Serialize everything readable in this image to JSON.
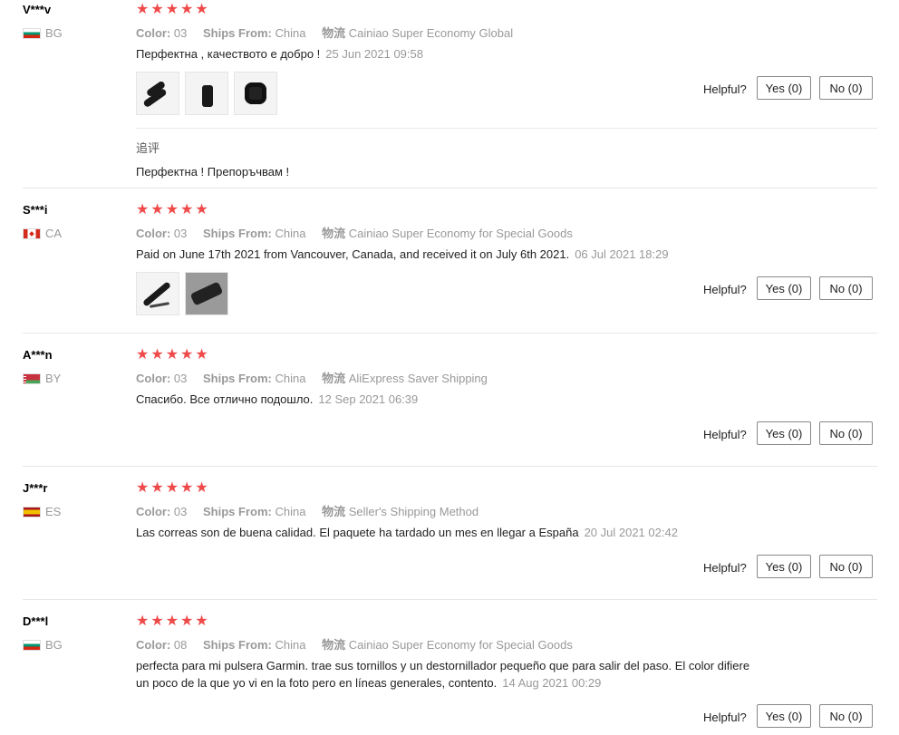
{
  "labels": {
    "color": "Color:",
    "ships_from": "Ships From:",
    "shipping": "物流",
    "helpful": "Helpful?"
  },
  "reviews": [
    {
      "user": "V***v",
      "country": "BG",
      "rating": 5,
      "color": "03",
      "ships_from": "China",
      "shipping": "Cainiao Super Economy Global",
      "text": "Перфектна , качеството е добро !",
      "date": "25 Jun 2021 09:58",
      "photo_count": 3,
      "yes": "Yes (0)",
      "no": "No (0)",
      "followup_label": "追评",
      "followup_text": "Перфектна ! Препоръчвам !"
    },
    {
      "user": "S***i",
      "country": "CA",
      "rating": 5,
      "color": "03",
      "ships_from": "China",
      "shipping": "Cainiao Super Economy for Special Goods",
      "text": "Paid on June 17th 2021 from Vancouver, Canada, and received it on July 6th 2021.",
      "date": "06 Jul 2021 18:29",
      "photo_count": 2,
      "yes": "Yes (0)",
      "no": "No (0)"
    },
    {
      "user": "A***n",
      "country": "BY",
      "rating": 5,
      "color": "03",
      "ships_from": "China",
      "shipping": "AliExpress Saver Shipping",
      "text": "Спасибо. Все отлично подошло.",
      "date": "12 Sep 2021 06:39",
      "yes": "Yes (0)",
      "no": "No (0)"
    },
    {
      "user": "J***r",
      "country": "ES",
      "rating": 5,
      "color": "03",
      "ships_from": "China",
      "shipping": "Seller's Shipping Method",
      "text": "Las correas son de buena calidad. El paquete ha tardado un mes en llegar a España",
      "date": "20 Jul 2021 02:42",
      "yes": "Yes (0)",
      "no": "No (0)"
    },
    {
      "user": "D***l",
      "country": "BG",
      "rating": 5,
      "color": "08",
      "ships_from": "China",
      "shipping": "Cainiao Super Economy for Special Goods",
      "text_line1": "perfecta para mi pulsera Garmin. trae sus tornillos y un destornillador pequeño que para salir del paso. El color difiere",
      "text_line2": "un poco de la que yo vi en la foto pero en líneas generales, contento.",
      "date": "14 Aug 2021 00:29",
      "yes": "Yes (0)",
      "no": "No (0)"
    }
  ]
}
